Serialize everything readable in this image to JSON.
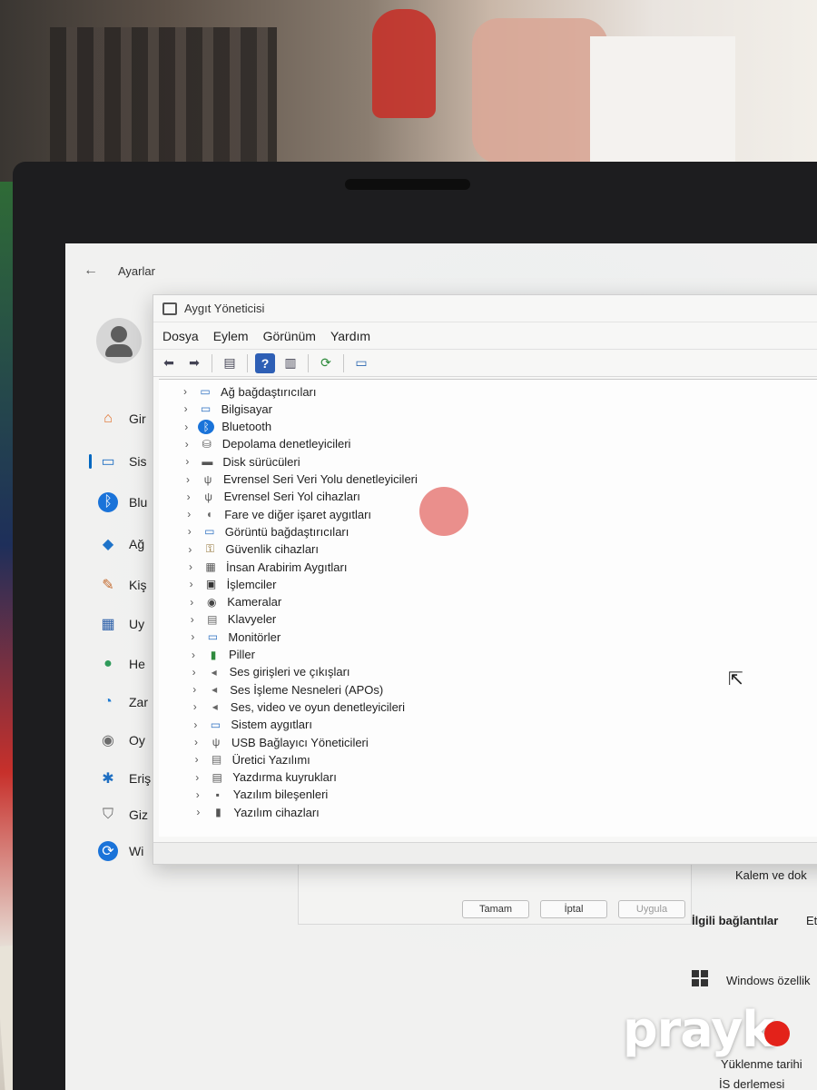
{
  "settings": {
    "back_label": "←",
    "title": "Ayarlar",
    "nav": [
      {
        "label": "Gir",
        "icon": "home-icon"
      },
      {
        "label": "Sis",
        "icon": "system-icon"
      },
      {
        "label": "Blu",
        "icon": "bluetooth-icon"
      },
      {
        "label": "Ağ",
        "icon": "network-icon"
      },
      {
        "label": "Kiş",
        "icon": "personalization-icon"
      },
      {
        "label": "Uy",
        "icon": "apps-icon"
      },
      {
        "label": "He",
        "icon": "accounts-icon"
      },
      {
        "label": "Zar",
        "icon": "time-icon"
      },
      {
        "label": "Oy",
        "icon": "gaming-icon"
      },
      {
        "label": "Eriş",
        "icon": "accessibility-icon"
      },
      {
        "label": "Giz",
        "icon": "privacy-icon"
      },
      {
        "label": "Wi",
        "icon": "windows-update-icon"
      }
    ]
  },
  "device_manager": {
    "title": "Aygıt Yöneticisi",
    "menu": [
      "Dosya",
      "Eylem",
      "Görünüm",
      "Yardım"
    ],
    "devices": [
      "Ağ bağdaştırıcıları",
      "Bilgisayar",
      "Bluetooth",
      "Depolama denetleyicileri",
      "Disk sürücüleri",
      "Evrensel Seri Veri Yolu denetleyicileri",
      "Evrensel Seri Yol cihazları",
      "Fare ve diğer işaret aygıtları",
      "Görüntü bağdaştırıcıları",
      "Güvenlik cihazları",
      "İnsan Arabirim Aygıtları",
      "İşlemciler",
      "Kameralar",
      "Klavyeler",
      "Monitörler",
      "Piller",
      "Ses girişleri ve çıkışları",
      "Ses İşleme Nesneleri (APOs)",
      "Ses, video ve oyun denetleyicileri",
      "Sistem aygıtları",
      "USB Bağlayıcı Yöneticileri",
      "Üretici Yazılımı",
      "Yazdırma kuyrukları",
      "Yazılım bileşenleri",
      "Yazılım cihazları"
    ]
  },
  "dialog": {
    "ok": "Tamam",
    "cancel": "İptal",
    "apply": "Uygula"
  },
  "right_panel": {
    "pen": "Kalem ve dok",
    "related": "İlgili bağlantılar",
    "related_more": "Et",
    "windows_spec": "Windows özellik",
    "install_date": "Yüklenme tarihi",
    "os_build": "İS derlemesi"
  },
  "watermark": "prayk"
}
